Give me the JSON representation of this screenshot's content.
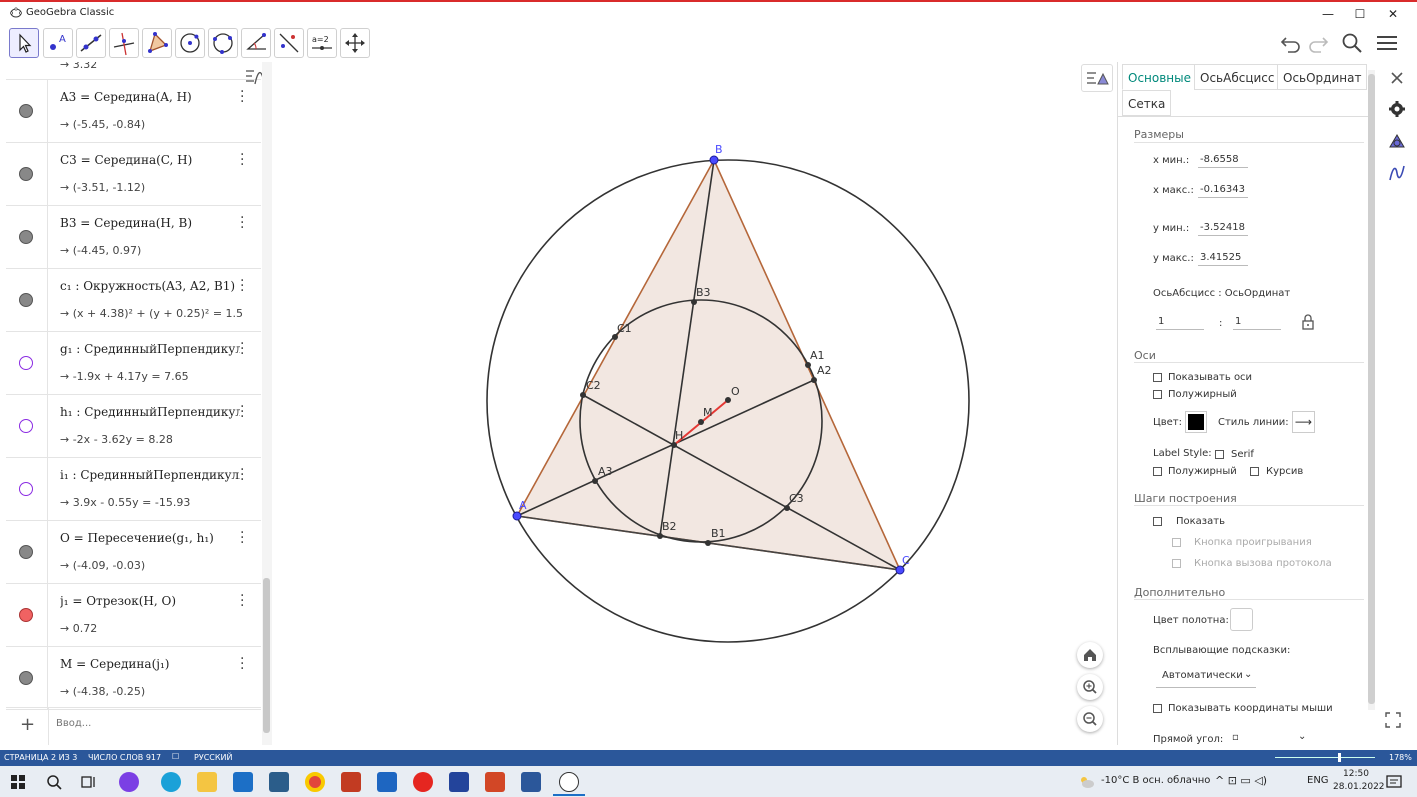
{
  "app": {
    "title": "GeoGebra Classic"
  },
  "toolbar": {
    "tools": [
      "move-tool",
      "point-tool",
      "line-tool",
      "perpendicular-tool",
      "polygon-tool",
      "circle-center-tool",
      "circle-3pts-tool",
      "angle-tool",
      "reflect-tool",
      "slider-tool",
      "move-view-tool"
    ],
    "slider_label": "a=2"
  },
  "algebra": {
    "top_partial_value": "→ 3.32",
    "rows": [
      {
        "def": "A3 = Середина(A, H)",
        "value": "→ (-5.45, -0.84)",
        "dot": "gray"
      },
      {
        "def": "C3 = Середина(C, H)",
        "value": "→ (-3.51, -1.12)",
        "dot": "gray"
      },
      {
        "def": "B3 = Середина(H, B)",
        "value": "→ (-4.45, 0.97)",
        "dot": "gray"
      },
      {
        "def": "c₁ : Окружность(A3, A2, B1)",
        "value": "→ (x + 4.38)² + (y + 0.25)² = 1.5",
        "dot": "gray"
      },
      {
        "def": "g₁ : СрединныйПерпендикуляр(a)",
        "value": "→ -1.9x + 4.17y = 7.65",
        "dot": "open"
      },
      {
        "def": "h₁ : СрединныйПерпендикуляр(c)",
        "value": "→ -2x - 3.62y = 8.28",
        "dot": "open"
      },
      {
        "def": "i₁ : СрединныйПерпендикуляр(b)",
        "value": "→ 3.9x - 0.55y = -15.93",
        "dot": "open"
      },
      {
        "def": "O = Пересечение(g₁, h₁)",
        "value": "→ (-4.09, -0.03)",
        "dot": "gray"
      },
      {
        "def": "j₁ = Отрезок(H, O)",
        "value": "→ 0.72",
        "dot": "red"
      },
      {
        "def": "M = Середина(j₁)",
        "value": "→ (-4.38, -0.25)",
        "dot": "gray"
      }
    ],
    "input_placeholder": "Ввод..."
  },
  "graphics": {
    "points": {
      "A": "A",
      "B": "B",
      "C": "C",
      "H": "H",
      "O": "O",
      "M": "M",
      "A1": "A1",
      "A2": "A2",
      "A3": "A3",
      "B1": "B1",
      "B2": "B2",
      "B3": "B3",
      "C1": "C1",
      "C2": "C2",
      "C3": "C3"
    }
  },
  "props": {
    "tabs": [
      "Основные",
      "ОсьАбсцисс",
      "ОсьОрдинат",
      "Сетка"
    ],
    "active_tab": "Основные",
    "size_section": "Размеры",
    "xmin_label": "x мин.:",
    "xmin": "-8.6558",
    "xmax_label": "x макс.:",
    "xmax": "-0.16343",
    "ymin_label": "y мин.:",
    "ymin": "-3.52418",
    "ymax_label": "y макс.:",
    "ymax": "3.41525",
    "ratio_label": "ОсьАбсцисс : ОсьОрдинат",
    "ratio_x": "1",
    "ratio_sep": ":",
    "ratio_y": "1",
    "axes_section": "Оси",
    "show_axes": "Показывать оси",
    "bold": "Полужирный",
    "color_label": "Цвет:",
    "line_style_label": "Стиль линии:",
    "label_style": "Label Style:",
    "serif": "Serif",
    "bold2": "Полужирный",
    "italic": "Курсив",
    "steps_section": "Шаги построения",
    "show": "Показать",
    "play_button": "Кнопка проигрывания",
    "protocol_button": "Кнопка вызова протокола",
    "extra_section": "Дополнительно",
    "bg_color": "Цвет полотна:",
    "tooltips_label": "Всплывающие подсказки:",
    "tooltips_value": "Автоматически",
    "show_mouse": "Показывать координаты мыши",
    "right_angle": "Прямой угол:",
    "right_angle_value": "▫"
  },
  "statusbar": {
    "page": "СТРАНИЦА 2 ИЗ 3",
    "words": "ЧИСЛО СЛОВ 917",
    "lang": "РУССКИЙ",
    "zoom": "178%"
  },
  "taskbar": {
    "weather": "-10°C  В осн. облачно",
    "lang": "ENG",
    "time": "12:50",
    "date": "28.01.2022"
  }
}
